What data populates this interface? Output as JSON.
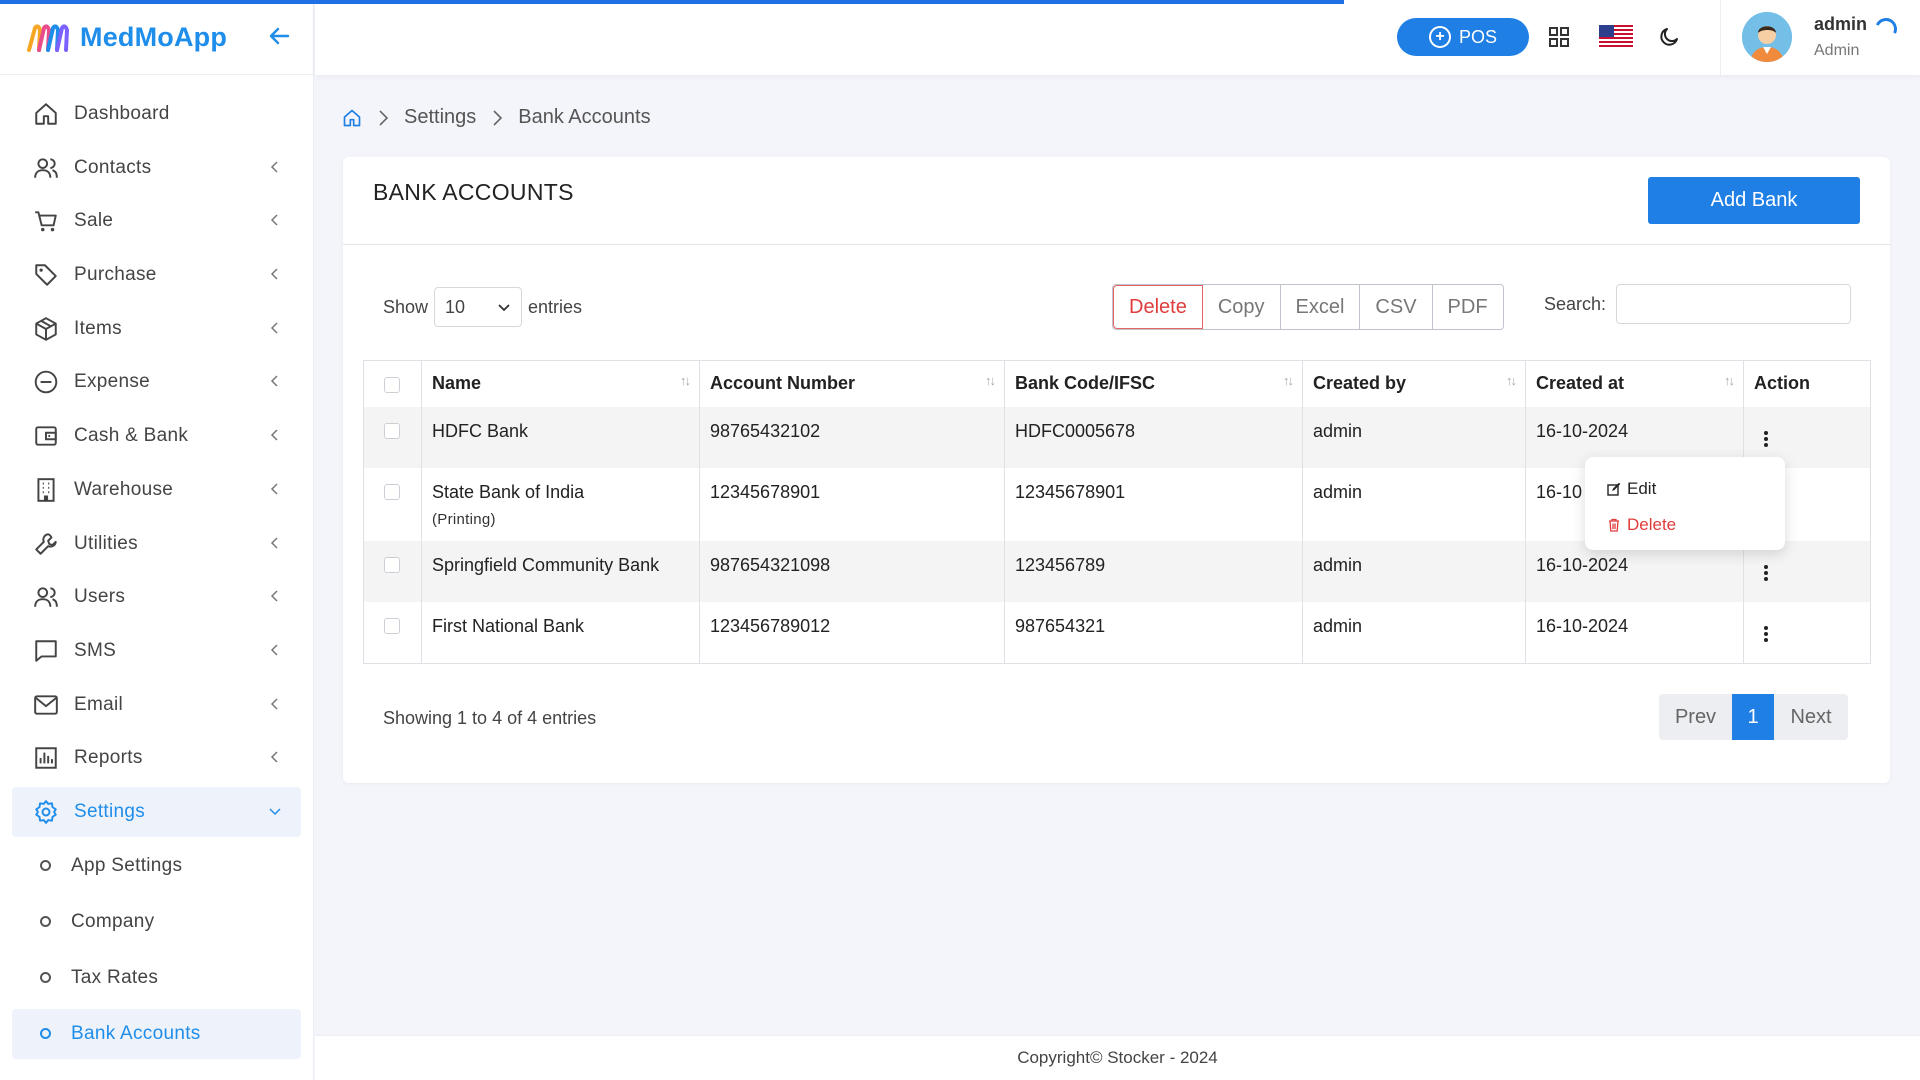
{
  "header": {
    "progress": 0.7,
    "app_name": "MedMoApp",
    "pos_label": "POS",
    "user_name": "admin",
    "user_role": "Admin"
  },
  "sidebar": {
    "items": [
      {
        "label": "Dashboard",
        "icon": "home-icon"
      },
      {
        "label": "Contacts",
        "icon": "users-icon"
      },
      {
        "label": "Sale",
        "icon": "cart-icon"
      },
      {
        "label": "Purchase",
        "icon": "tag-icon"
      },
      {
        "label": "Items",
        "icon": "box-icon"
      },
      {
        "label": "Expense",
        "icon": "minus-circle-icon"
      },
      {
        "label": "Cash & Bank",
        "icon": "wallet-icon"
      },
      {
        "label": "Warehouse",
        "icon": "building-icon"
      },
      {
        "label": "Utilities",
        "icon": "wrench-icon"
      },
      {
        "label": "Users",
        "icon": "users-icon"
      },
      {
        "label": "SMS",
        "icon": "message-icon"
      },
      {
        "label": "Email",
        "icon": "mail-icon"
      },
      {
        "label": "Reports",
        "icon": "chart-icon"
      },
      {
        "label": "Settings",
        "icon": "gear-icon"
      }
    ],
    "settings_sub": [
      {
        "label": "App Settings"
      },
      {
        "label": "Company"
      },
      {
        "label": "Tax Rates"
      },
      {
        "label": "Bank Accounts"
      }
    ]
  },
  "breadcrumb": {
    "settings": "Settings",
    "current": "Bank Accounts"
  },
  "card": {
    "title": "BANK ACCOUNTS",
    "add_button": "Add Bank",
    "show_label": "Show",
    "entries_label": "entries",
    "page_length": "10",
    "search_label": "Search:",
    "export_buttons": {
      "delete": "Delete",
      "copy": "Copy",
      "excel": "Excel",
      "csv": "CSV",
      "pdf": "PDF"
    }
  },
  "table": {
    "columns": [
      "Name",
      "Account Number",
      "Bank Code/IFSC",
      "Created by",
      "Created at",
      "Action"
    ],
    "rows": [
      {
        "name": "HDFC Bank",
        "note": "",
        "account": "98765432102",
        "code": "HDFC0005678",
        "created_by": "admin",
        "created_at": "16-10-2024"
      },
      {
        "name": "State Bank of India",
        "note": "(Printing)",
        "account": "12345678901",
        "code": "12345678901",
        "created_by": "admin",
        "created_at": "16-10"
      },
      {
        "name": "Springfield Community Bank",
        "note": "",
        "account": "987654321098",
        "code": "123456789",
        "created_by": "admin",
        "created_at": "16-10-2024"
      },
      {
        "name": "First National Bank",
        "note": "",
        "account": "123456789012",
        "code": "987654321",
        "created_by": "admin",
        "created_at": "16-10-2024"
      }
    ]
  },
  "action_menu": {
    "edit": "Edit",
    "delete": "Delete"
  },
  "info": "Showing 1 to 4 of 4 entries",
  "pagination": {
    "prev": "Prev",
    "page": "1",
    "next": "Next"
  },
  "footer": "Copyright© Stocker - 2024",
  "colors": {
    "accent": "#1f7fe5",
    "danger": "#e03c3c",
    "brand": "#1f8dea"
  }
}
